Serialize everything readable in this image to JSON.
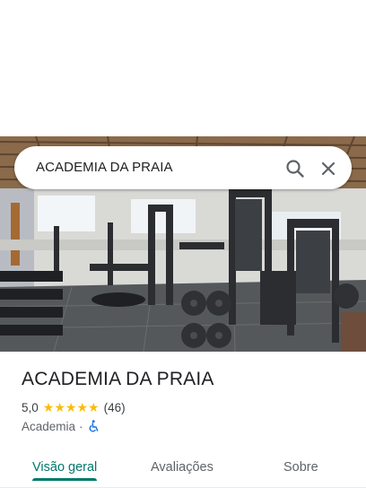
{
  "search": {
    "query": "ACADEMIA DA PRAIA"
  },
  "place": {
    "name": "ACADEMIA DA PRAIA",
    "rating": "5,0",
    "stars": 5,
    "review_count": "(46)",
    "category": "Academia",
    "separator": "·"
  },
  "tabs": [
    {
      "label": "Visão geral",
      "active": true
    },
    {
      "label": "Avaliações",
      "active": false
    },
    {
      "label": "Sobre",
      "active": false
    }
  ],
  "icons": {
    "search": "search-icon",
    "close": "close-icon",
    "accessibility": "wheelchair-icon",
    "star": "star-icon"
  },
  "colors": {
    "accent": "#00796b",
    "star": "#fbbc04",
    "accessibility": "#1a73e8"
  }
}
